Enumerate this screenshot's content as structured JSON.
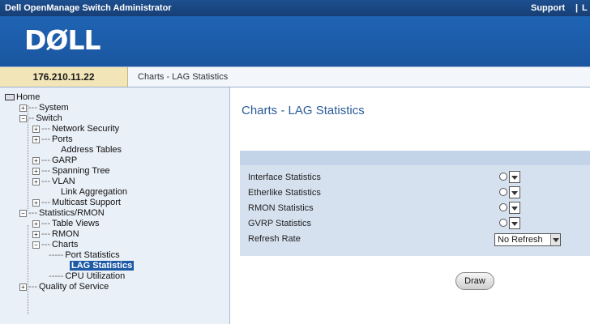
{
  "titlebar": {
    "app_title": "Dell OpenManage Switch Administrator",
    "support_link": "Support",
    "separator": "|",
    "more": "L"
  },
  "banner": {
    "logo_text": "DØLL"
  },
  "addrbar": {
    "ip": "176.210.11.22",
    "breadcrumb": "Charts - LAG Statistics"
  },
  "tree": {
    "home": "Home",
    "system": "System",
    "switch": "Switch",
    "network_security": "Network Security",
    "ports": "Ports",
    "address_tables": "Address Tables",
    "garp": "GARP",
    "spanning_tree": "Spanning Tree",
    "vlan": "VLAN",
    "link_aggregation": "Link Aggregation",
    "multicast_support": "Multicast Support",
    "statistics_rmon": "Statistics/RMON",
    "table_views": "Table Views",
    "rmon": "RMON",
    "charts": "Charts",
    "port_statistics": "Port Statistics",
    "lag_statistics": "LAG Statistics",
    "cpu_utilization": "CPU Utilization",
    "quality_of_service": "Quality of Service"
  },
  "main": {
    "page_title": "Charts - LAG Statistics",
    "rows": [
      {
        "label": "Interface Statistics"
      },
      {
        "label": "Etherlike Statistics"
      },
      {
        "label": "RMON Statistics"
      },
      {
        "label": "GVRP Statistics"
      }
    ],
    "refresh_rate_label": "Refresh Rate",
    "refresh_rate_value": "No Refresh",
    "draw_button": "Draw"
  },
  "colors": {
    "titlebar": "#1d4f8f",
    "banner": "#1f64b4",
    "ip_box": "#f2e6b8",
    "tree_bg": "#eaf0f8",
    "panel_bg": "#d6e1ef",
    "selected": "#1e5aa6",
    "page_title": "#2b5c99"
  },
  "icons": {
    "home": "home-icon",
    "expand": "plus-box-icon",
    "collapse": "minus-box-icon"
  }
}
